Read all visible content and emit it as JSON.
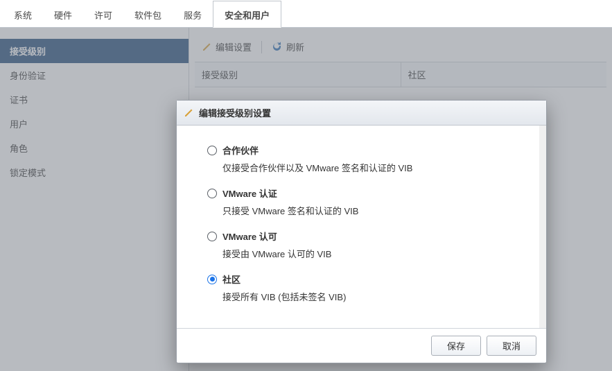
{
  "tabs": {
    "items": [
      {
        "label": "系统"
      },
      {
        "label": "硬件"
      },
      {
        "label": "许可"
      },
      {
        "label": "软件包"
      },
      {
        "label": "服务"
      },
      {
        "label": "安全和用户"
      }
    ],
    "active_index": 5
  },
  "sidebar": {
    "items": [
      {
        "label": "接受级别"
      },
      {
        "label": "身份验证"
      },
      {
        "label": "证书"
      },
      {
        "label": "用户"
      },
      {
        "label": "角色"
      },
      {
        "label": "锁定模式"
      }
    ],
    "active_index": 0
  },
  "toolbar": {
    "edit_label": "编辑设置",
    "refresh_label": "刷新"
  },
  "acceptance": {
    "key_label": "接受级别",
    "value": "社区"
  },
  "dialog": {
    "title": "编辑接受级别设置",
    "options": [
      {
        "label": "合作伙伴",
        "desc": "仅接受合作伙伴以及 VMware 签名和认证的 VIB",
        "selected": false
      },
      {
        "label": "VMware 认证",
        "desc": "只接受 VMware 签名和认证的 VIB",
        "selected": false
      },
      {
        "label": "VMware 认可",
        "desc": "接受由 VMware 认可的 VIB",
        "selected": false
      },
      {
        "label": "社区",
        "desc": "接受所有 VIB (包括未签名 VIB)",
        "selected": true
      }
    ],
    "save_label": "保存",
    "cancel_label": "取消"
  },
  "colors": {
    "primary": "#234c7a",
    "accent": "#1a73e8"
  }
}
